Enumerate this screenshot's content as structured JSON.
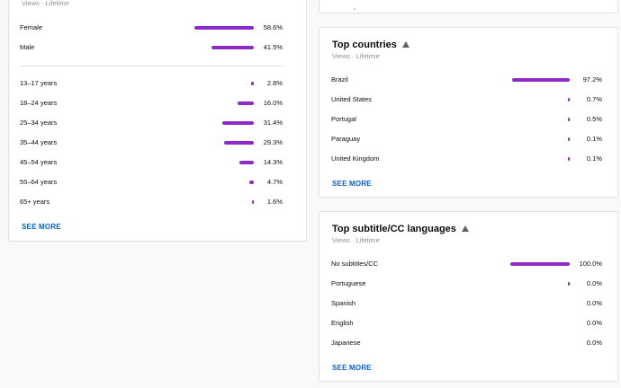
{
  "left_card": {
    "subtitle": "Views · Lifetime",
    "gender_rows": [
      {
        "label": "Female",
        "value": "58.6%",
        "pct": 58.6
      },
      {
        "label": "Male",
        "value": "41.5%",
        "pct": 41.5
      }
    ],
    "age_rows": [
      {
        "label": "13–17 years",
        "value": "2.8%",
        "pct": 2.8
      },
      {
        "label": "18–24 years",
        "value": "16.0%",
        "pct": 16.0
      },
      {
        "label": "25–34 years",
        "value": "31.4%",
        "pct": 31.4
      },
      {
        "label": "35–44 years",
        "value": "29.3%",
        "pct": 29.3
      },
      {
        "label": "45–54 years",
        "value": "14.3%",
        "pct": 14.3
      },
      {
        "label": "55–64 years",
        "value": "4.7%",
        "pct": 4.7
      },
      {
        "label": "65+ years",
        "value": "1.6%",
        "pct": 1.6
      }
    ],
    "see_more": "SEE MORE"
  },
  "top_stub": {
    "glyph": "⌄"
  },
  "countries_card": {
    "title": "Top countries",
    "subtitle": "Views · Lifetime",
    "rows": [
      {
        "label": "Brazil",
        "value": "97.2%",
        "pct": 97.2
      },
      {
        "label": "United States",
        "value": "0.7%",
        "pct": 0.7
      },
      {
        "label": "Portugal",
        "value": "0.5%",
        "pct": 0.5
      },
      {
        "label": "Paraguay",
        "value": "0.1%",
        "pct": 0.1
      },
      {
        "label": "United Kingdom",
        "value": "0.1%",
        "pct": 0.1
      }
    ],
    "see_more": "SEE MORE"
  },
  "subtitles_card": {
    "title": "Top subtitle/CC languages",
    "subtitle": "Views · Lifetime",
    "rows": [
      {
        "label": "No subtitles/CC",
        "value": "100.0%",
        "pct": 100.0
      },
      {
        "label": "Portuguese",
        "value": "0.0%",
        "pct": 0.04
      },
      {
        "label": "Spanish",
        "value": "0.0%",
        "pct": 0
      },
      {
        "label": "English",
        "value": "0.0%",
        "pct": 0
      },
      {
        "label": "Japanese",
        "value": "0.0%",
        "pct": 0
      }
    ],
    "see_more": "SEE MORE"
  },
  "colors": {
    "bar": "#8d2ac8",
    "link": "#065fd4"
  }
}
